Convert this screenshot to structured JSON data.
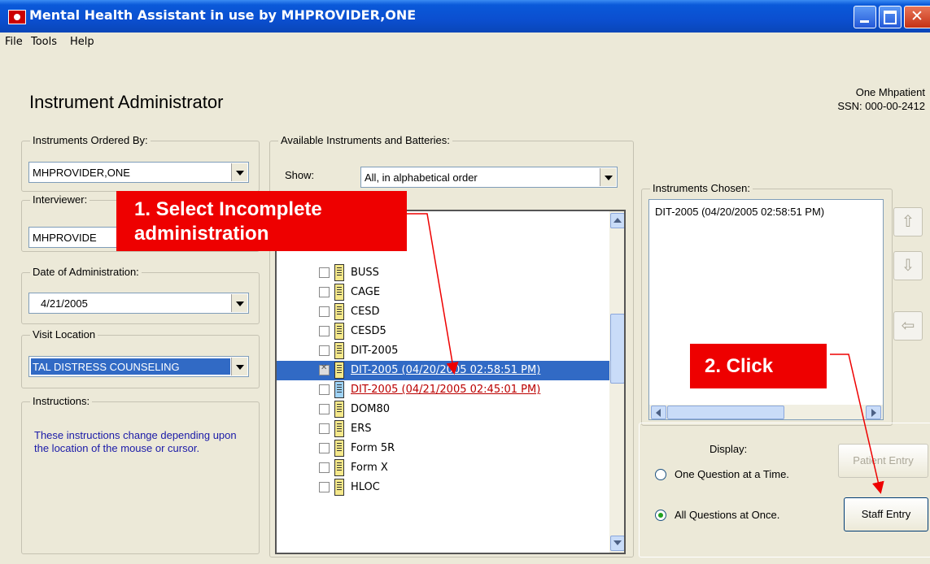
{
  "window": {
    "title": "Mental Health Assistant in use by MHPROVIDER,ONE"
  },
  "menu": [
    "File",
    "Tools",
    "Help"
  ],
  "page_title": "Instrument Administrator",
  "patient": {
    "name": "One Mhpatient",
    "ssn": "SSN: 000-00-2412"
  },
  "ordered_by": {
    "label": "Instruments Ordered By:",
    "value": "MHPROVIDER,ONE"
  },
  "interviewer": {
    "label": "Interviewer:",
    "value": "MHPROVIDE"
  },
  "date": {
    "label": "Date of Administration:",
    "value": "4/21/2005"
  },
  "visit": {
    "label": "Visit Location",
    "value": "TAL DISTRESS COUNSELING"
  },
  "instructions": {
    "label": "Instructions:",
    "text": "These instructions change depending upon the location of the mouse or cursor."
  },
  "available": {
    "label": "Available Instruments and Batteries:",
    "show_label": "Show:",
    "show_value": "All, in alphabetical order",
    "items": [
      {
        "label": "BUSS"
      },
      {
        "label": "CAGE"
      },
      {
        "label": "CESD"
      },
      {
        "label": "CESD5"
      },
      {
        "label": "DIT-2005"
      },
      {
        "label": "DIT-2005  (04/20/2005 02:58:51 PM)",
        "selected": true
      },
      {
        "label": "DIT-2005  (04/21/2005 02:45:01 PM)",
        "incomplete": true
      },
      {
        "label": "DOM80"
      },
      {
        "label": "ERS"
      },
      {
        "label": "Form 5R"
      },
      {
        "label": "Form X"
      },
      {
        "label": "HLOC"
      }
    ]
  },
  "chosen": {
    "label": "Instruments Chosen:",
    "items": [
      "DIT-2005  (04/20/2005 02:58:51 PM)"
    ]
  },
  "display": {
    "label": "Display:",
    "option1": "One Question at a Time.",
    "option2": "All Questions at Once.",
    "selected": "option2"
  },
  "buttons": {
    "patient_entry": "Patient Entry",
    "staff_entry": "Staff Entry"
  },
  "annotations": {
    "step1": "1. Select Incomplete administration",
    "step2": "2. Click"
  },
  "colors": {
    "annotation": "#ee0000",
    "selection": "#316ac5",
    "incomplete_text": "#b00000",
    "titlebar": "#0a59d9"
  }
}
